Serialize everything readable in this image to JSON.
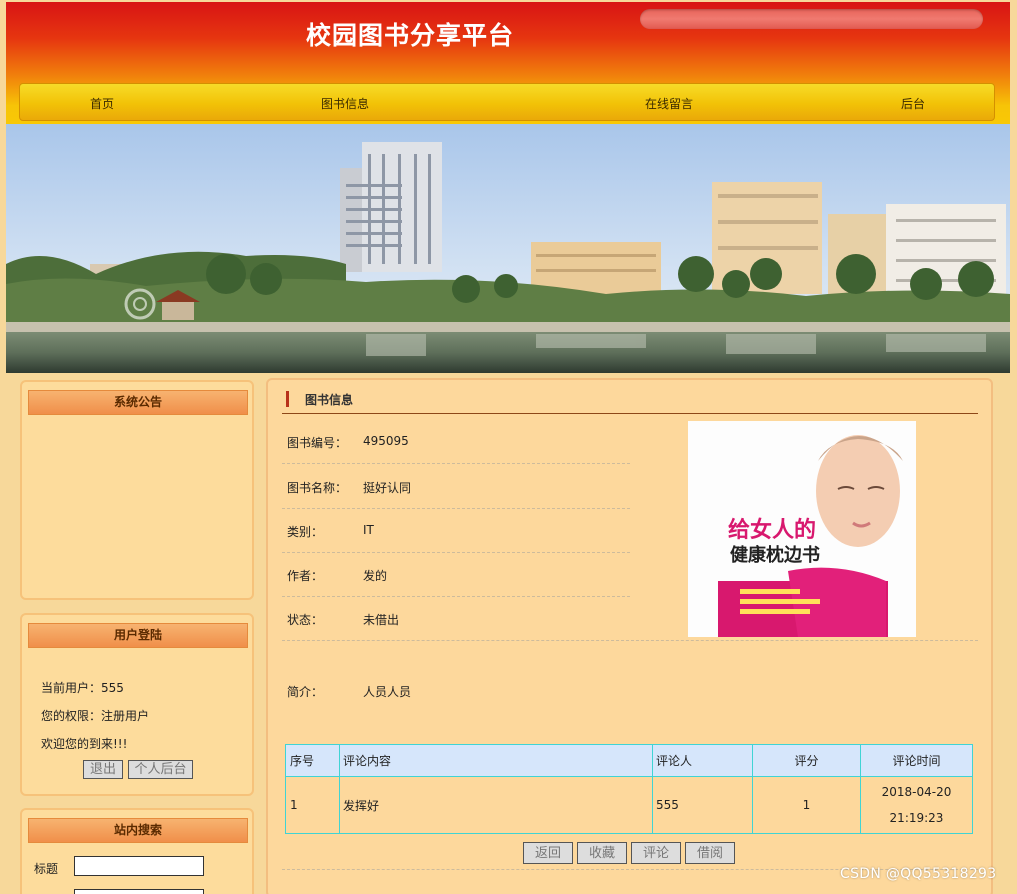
{
  "header": {
    "site_title": "校园图书分享平台",
    "nav": [
      {
        "label": "首页"
      },
      {
        "label": "图书信息"
      },
      {
        "label": "在线留言"
      },
      {
        "label": "后台"
      }
    ]
  },
  "sidebar": {
    "notice": {
      "title": "系统公告"
    },
    "login": {
      "title": "用户登陆",
      "current_user": "当前用户：555",
      "permission": "您的权限：注册用户",
      "welcome": "欢迎您的到来!!!",
      "logout_label": "退出",
      "profile_label": "个人后台"
    },
    "search": {
      "title": "站内搜索",
      "title_field_label": "标题"
    }
  },
  "main": {
    "section_title": "图书信息",
    "fields": [
      {
        "label": "图书编号：",
        "value": "495095"
      },
      {
        "label": "图书名称：",
        "value": "挺好认同"
      },
      {
        "label": "类别：",
        "value": "IT"
      },
      {
        "label": "作者：",
        "value": "发的"
      },
      {
        "label": "状态：",
        "value": "未借出"
      }
    ],
    "intro": {
      "label": "简介：",
      "value": "人员人员"
    },
    "cover_text": "给女人的健康枕边书",
    "comments": {
      "headers": [
        "序号",
        "评论内容",
        "评论人",
        "评分",
        "评论时间"
      ],
      "rows": [
        {
          "index": "1",
          "content": "发挥好",
          "author": "555",
          "score": "1",
          "date": "2018-04-20",
          "time": "21:19:23"
        }
      ]
    },
    "actions": [
      "返回",
      "收藏",
      "评论",
      "借阅"
    ]
  },
  "watermark": "CSDN @QQ55318293",
  "colors": {
    "header_top": "#d81414",
    "nav_yellow": "#f2c207",
    "page_bg": "#f7d89a",
    "panel_head": "#f08f4a",
    "table_border": "#40d4d4",
    "table_head": "#d6e6fb"
  }
}
